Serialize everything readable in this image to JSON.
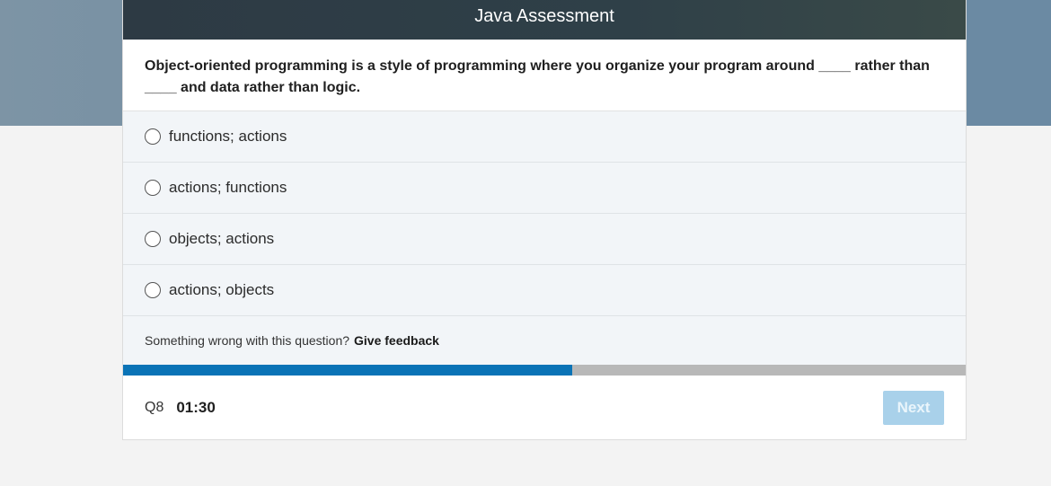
{
  "header": {
    "title": "Java Assessment"
  },
  "question": {
    "text": "Object-oriented programming is a style of programming where you organize your program around ____ rather than ____ and data rather than logic."
  },
  "options": [
    {
      "label": "functions; actions"
    },
    {
      "label": "actions; functions"
    },
    {
      "label": "objects; actions"
    },
    {
      "label": "actions; objects"
    }
  ],
  "feedback": {
    "prompt": "Something wrong with this question?",
    "link": "Give feedback"
  },
  "progress": {
    "fraction": 0.533
  },
  "footer": {
    "question_number": "Q8",
    "timer": "01:30",
    "next_label": "Next"
  },
  "colors": {
    "progress_fill": "#0a73b6",
    "progress_track": "#b8b8b8",
    "next_disabled": "#a9d1ea",
    "header_bg": "#2d3a44"
  }
}
